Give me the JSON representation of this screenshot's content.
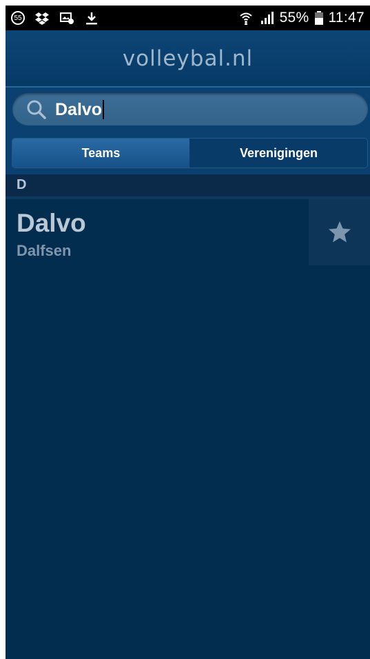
{
  "status_bar": {
    "notification_count": "55",
    "battery": "55%",
    "time": "11:47",
    "icons": [
      "dropbox-icon",
      "screenshot-icon",
      "download-icon",
      "wifi-icon",
      "signal-icon",
      "battery-icon"
    ]
  },
  "header": {
    "logo_text": "volleybal.nl"
  },
  "search": {
    "value": "Dalvo",
    "icon": "search-icon"
  },
  "tabs": [
    {
      "label": "Teams",
      "selected": true
    },
    {
      "label": "Verenigingen",
      "selected": false
    }
  ],
  "section": {
    "letter": "D"
  },
  "results": [
    {
      "title": "Dalvo",
      "subtitle": "Dalfsen",
      "favorite_icon": "star-icon"
    }
  ],
  "colors": {
    "background": "#032d4f",
    "header": "#0d4576",
    "tab_selected": "#2a6aa4",
    "text_primary": "#bac7d4",
    "text_secondary": "#8096ad"
  }
}
